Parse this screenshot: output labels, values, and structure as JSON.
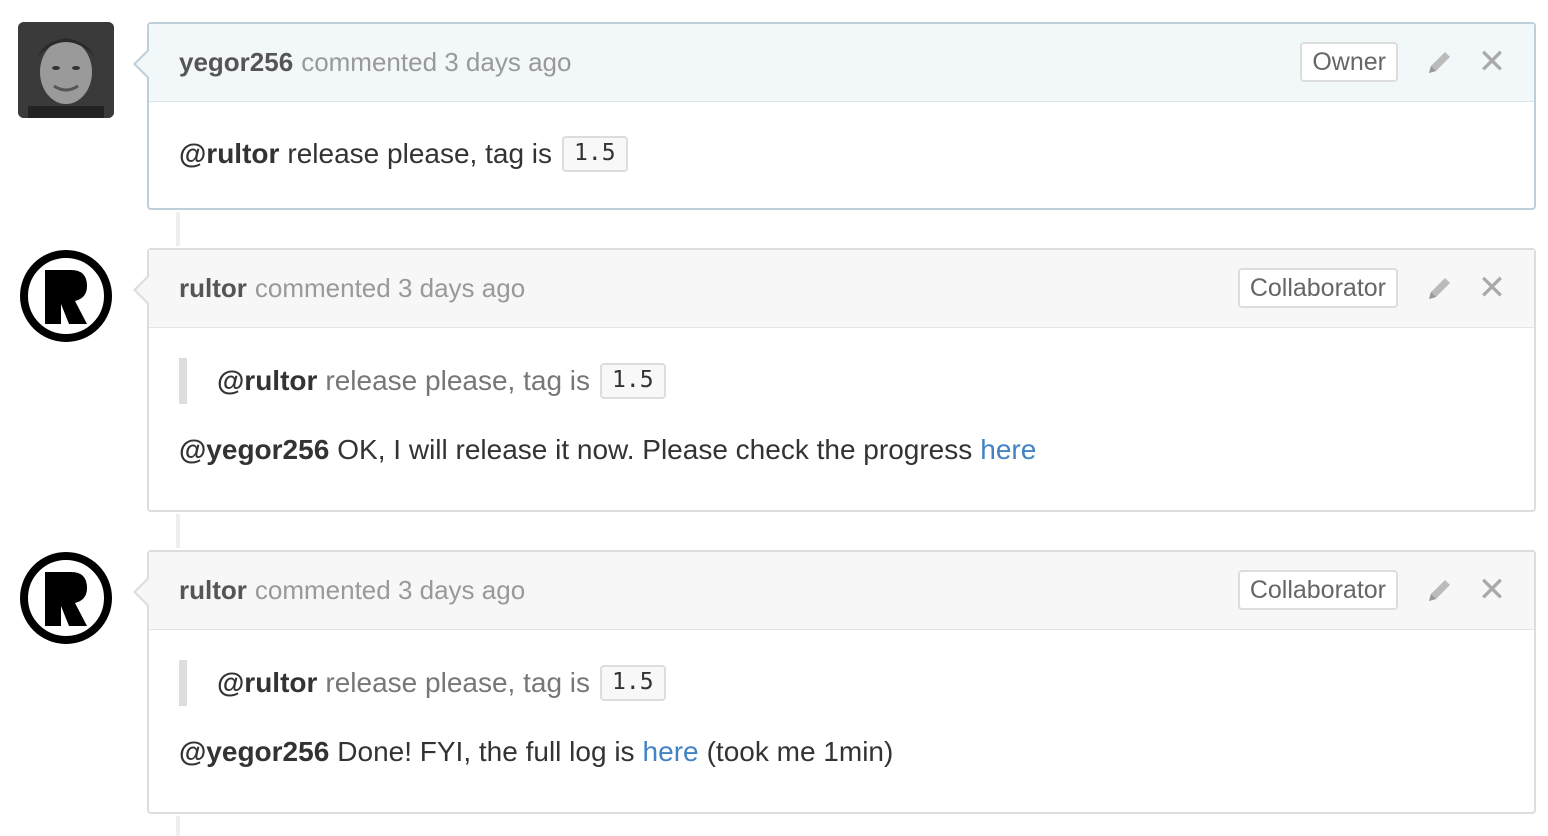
{
  "comments": [
    {
      "author": "yegor256",
      "meta": "commented 3 days ago",
      "role": "Owner",
      "avatar_icon": "user-photo",
      "body": {
        "mention": "@rultor",
        "text": "release please, tag is",
        "code": "1.5"
      }
    },
    {
      "author": "rultor",
      "meta": "commented 3 days ago",
      "role": "Collaborator",
      "avatar_icon": "rultor-logo",
      "quote": {
        "mention": "@rultor",
        "text": "release please, tag is",
        "code": "1.5"
      },
      "body": {
        "mention": "@yegor256",
        "text": "OK, I will release it now. Please check the progress",
        "link": "here",
        "after": ""
      }
    },
    {
      "author": "rultor",
      "meta": "commented 3 days ago",
      "role": "Collaborator",
      "avatar_icon": "rultor-logo",
      "quote": {
        "mention": "@rultor",
        "text": "release please, tag is",
        "code": "1.5"
      },
      "body": {
        "mention": "@yegor256",
        "text": "Done! FYI, the full log is",
        "link": "here",
        "after": "(took me 1min)"
      }
    }
  ],
  "colors": {
    "link": "#4183c4",
    "owner_header": "#f2f8fa",
    "header": "#f7f7f7"
  },
  "icons": {
    "edit": "pencil-icon",
    "delete": "close-icon"
  }
}
